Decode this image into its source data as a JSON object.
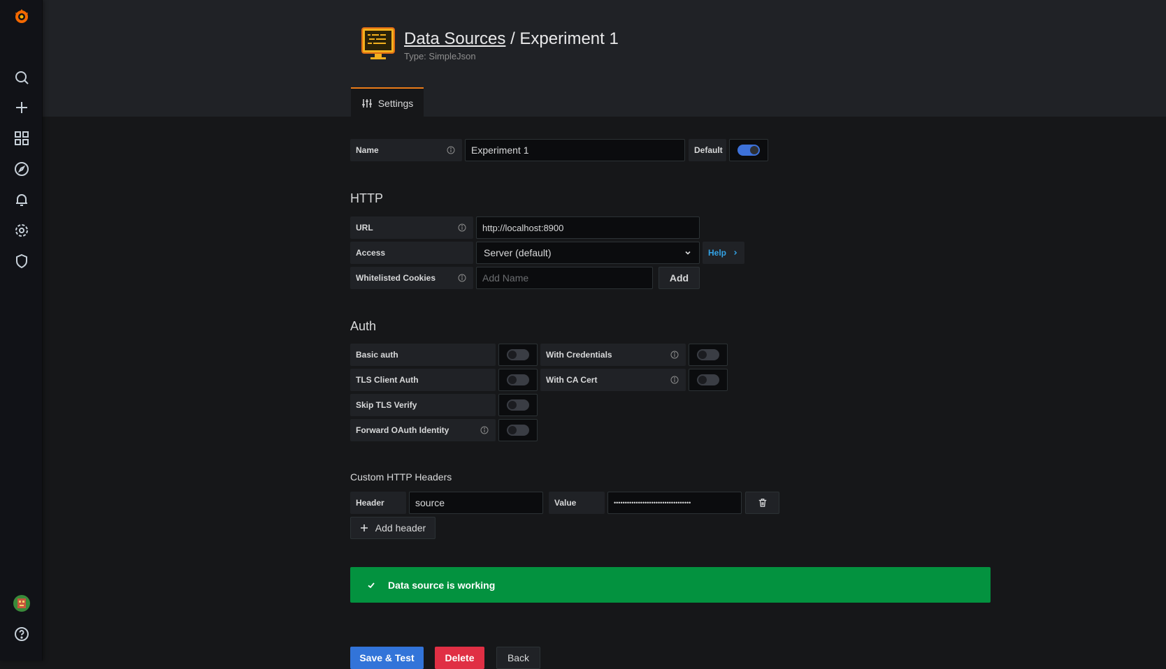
{
  "header": {
    "breadcrumb_link": "Data Sources",
    "separator": "/",
    "page_name": "Experiment 1",
    "subtitle": "Type: SimpleJson"
  },
  "tabs": [
    {
      "label": "Settings"
    }
  ],
  "settings": {
    "name_label": "Name",
    "name_value": "Experiment 1",
    "default_label": "Default",
    "default_enabled": true
  },
  "http": {
    "section_title": "HTTP",
    "url_label": "URL",
    "url_value": "http://localhost:8900",
    "access_label": "Access",
    "access_value": "Server (default)",
    "help_label": "Help",
    "cookies_label": "Whitelisted Cookies",
    "cookies_placeholder": "Add Name",
    "add_label": "Add"
  },
  "auth": {
    "section_title": "Auth",
    "basic_auth": "Basic auth",
    "with_credentials": "With Credentials",
    "tls_client_auth": "TLS Client Auth",
    "with_ca_cert": "With CA Cert",
    "skip_tls_verify": "Skip TLS Verify",
    "forward_oauth": "Forward OAuth Identity"
  },
  "custom_headers": {
    "section_title": "Custom HTTP Headers",
    "header_label": "Header",
    "header_value": "source",
    "value_label": "Value",
    "value_masked": "•••••••••••••••••••••••••••••••••••",
    "add_header_label": "Add header"
  },
  "alert": {
    "message": "Data source is working"
  },
  "actions": {
    "save_test": "Save & Test",
    "delete": "Delete",
    "back": "Back"
  },
  "colors": {
    "accent_tab": "#eb7b18",
    "primary": "#3274d9",
    "danger": "#e02f44",
    "success": "#03923f",
    "link": "#33a2e5"
  },
  "icons": [
    "grafana-logo-icon",
    "search-icon",
    "plus-icon",
    "dashboards-icon",
    "explore-compass-icon",
    "bell-icon",
    "gear-icon",
    "shield-icon",
    "avatar",
    "help-icon",
    "settings-sliders-icon",
    "info-icon",
    "chevron-down-icon",
    "chevron-right-icon",
    "trash-icon",
    "check-icon"
  ]
}
